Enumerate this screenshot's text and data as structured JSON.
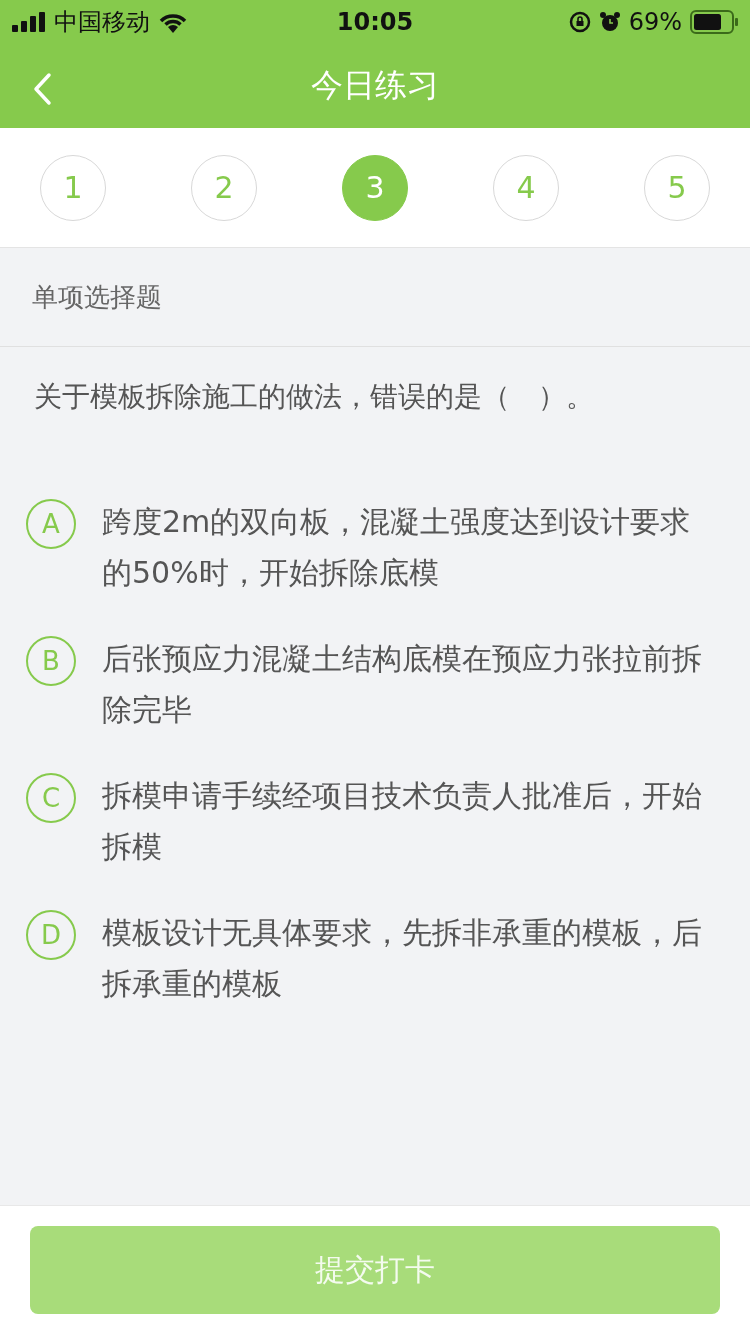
{
  "status_bar": {
    "carrier": "中国移动",
    "time": "10:05",
    "battery": "69%"
  },
  "header": {
    "title": "今日练习"
  },
  "questions_nav": [
    {
      "label": "1",
      "selected": false
    },
    {
      "label": "2",
      "selected": false
    },
    {
      "label": "3",
      "selected": true
    },
    {
      "label": "4",
      "selected": false
    },
    {
      "label": "5",
      "selected": false
    }
  ],
  "question_type": "单项选择题",
  "question": "关于模板拆除施工的做法，错误的是（　）。",
  "options": [
    {
      "letter": "A",
      "text": "跨度2m的双向板，混凝土强度达到设计要求的50%时，开始拆除底模",
      "selected": false
    },
    {
      "letter": "B",
      "text": "后张预应力混凝土结构底模在预应力张拉前拆除完毕",
      "selected": false
    },
    {
      "letter": "C",
      "text": "拆模申请手续经项目技术负责人批准后，开始拆模",
      "selected": false
    },
    {
      "letter": "D",
      "text": "模板设计无具体要求，先拆非承重的模板，后拆承重的模板",
      "selected": false
    }
  ],
  "submit": {
    "label": "提交打卡",
    "disabled": true
  }
}
